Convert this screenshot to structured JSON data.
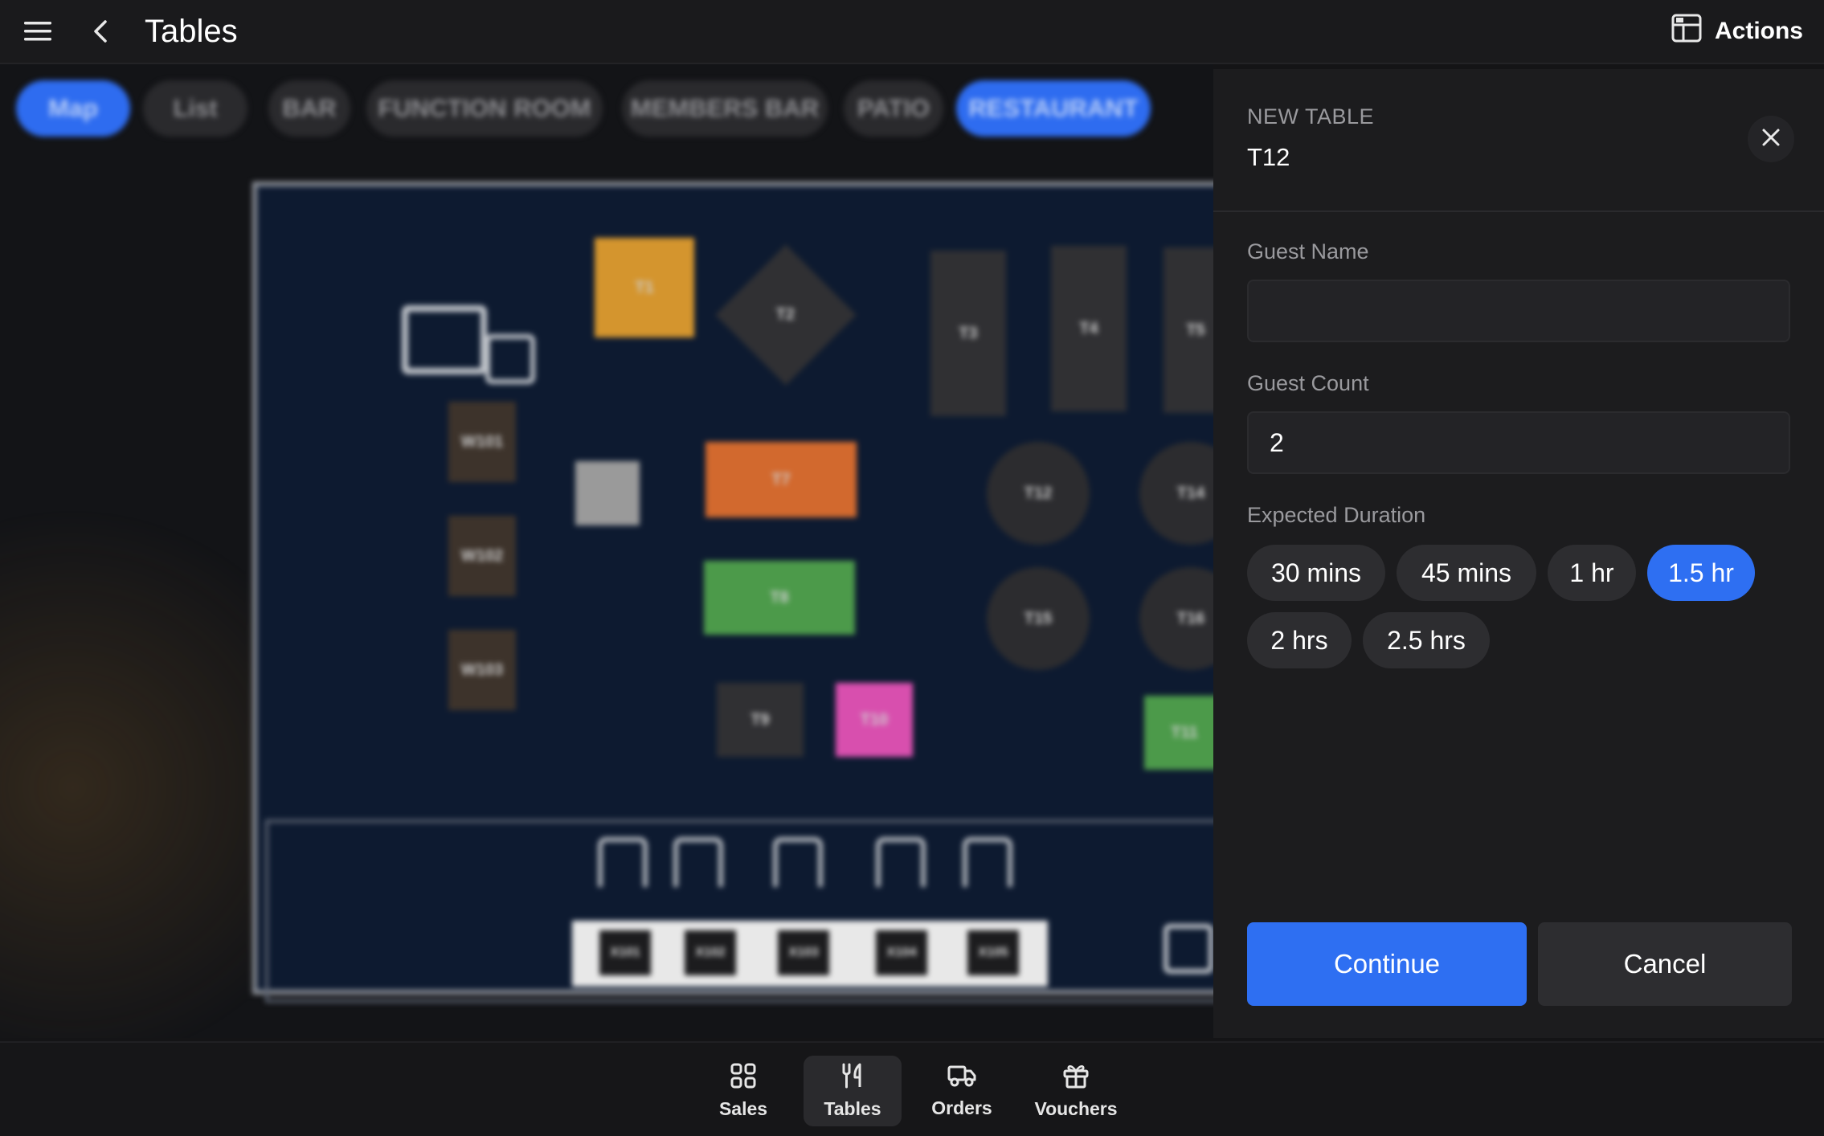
{
  "header": {
    "title": "Tables",
    "actions_label": "Actions"
  },
  "background": {
    "view_tabs": [
      "Map",
      "List"
    ],
    "area_tabs": [
      "BAR",
      "FUNCTION ROOM",
      "MEMBERS BAR",
      "PATIO",
      "RESTAURANT"
    ],
    "selected_area": "RESTAURANT",
    "tables": [
      "T1",
      "T2",
      "T3",
      "T4",
      "T5",
      "W101",
      "W102",
      "W103",
      "T7",
      "T8",
      "T9",
      "T10",
      "T11",
      "T12",
      "T14",
      "T15",
      "T16",
      "X101",
      "X102",
      "X103",
      "X104",
      "X105"
    ]
  },
  "modal": {
    "heading": "NEW TABLE",
    "table_name": "T12",
    "guest_name": {
      "label": "Guest Name",
      "value": ""
    },
    "guest_count": {
      "label": "Guest Count",
      "value": "2"
    },
    "duration": {
      "label": "Expected Duration",
      "options": [
        "30 mins",
        "45 mins",
        "1 hr",
        "1.5 hr",
        "2 hrs",
        "2.5 hrs"
      ],
      "selected": "1.5 hr"
    },
    "continue_label": "Continue",
    "cancel_label": "Cancel"
  },
  "bottom_nav": {
    "items": [
      "Sales",
      "Tables",
      "Orders",
      "Vouchers"
    ],
    "active": "Tables"
  },
  "colors": {
    "accent": "#2e6ff2",
    "panel": "#1c1c1e",
    "page": "#141416"
  }
}
